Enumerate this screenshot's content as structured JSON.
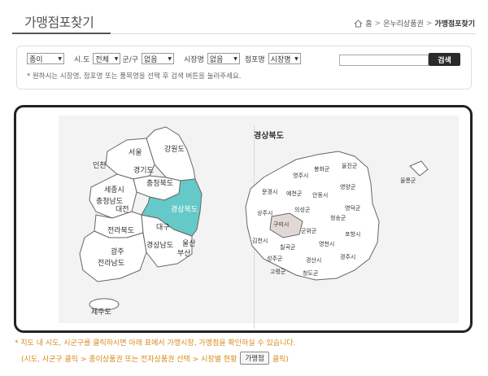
{
  "header": {
    "title": "가맹점포찾기",
    "breadcrumb": [
      "홈",
      "온누리상품권",
      "가맹점포찾기"
    ]
  },
  "search": {
    "type_select": "종이",
    "sido_label": "시.도",
    "sido_select": "전체",
    "gungu_label": "군/구",
    "gungu_select": "없음",
    "market_label": "시장명",
    "market_select": "없음",
    "store_label": "점포명",
    "store_select": "시장명",
    "query_value": "",
    "button_label": "검색",
    "hint": "* 원하시는 시장명, 점포명 또는 품목명을 선택 후 검색 버튼을 눌러주세요."
  },
  "map": {
    "korea_regions": [
      "서울",
      "강원도",
      "인천",
      "경기도",
      "충청북도",
      "세종시",
      "충청남도",
      "대전",
      "경상북도",
      "대구",
      "전라북도",
      "울산",
      "경상남도",
      "광주",
      "부산",
      "전라남도",
      "제주도"
    ],
    "province_title": "경상북도",
    "gb_regions": [
      "울릉군",
      "봉화군",
      "울진군",
      "영주시",
      "문경시",
      "예천군",
      "영양군",
      "안동시",
      "상주시",
      "의성군",
      "영덕군",
      "청송군",
      "구미시",
      "군위군",
      "포항시",
      "김천시",
      "칠곡군",
      "영천시",
      "성주군",
      "경산시",
      "경주시",
      "고령군",
      "청도군"
    ],
    "colors": {
      "highlight": "#66c9c9",
      "selected": "#e2d9d6",
      "frame_dark": "#222222",
      "frame_green": "#7ab62e"
    }
  },
  "notes": {
    "line1": "* 지도 내 시도, 시군구를 클릭하시면 아래 표에서 가맹시장, 가맹점을 확인하실 수 있습니다.",
    "line2_prefix": "(시도, 시군구 클릭 > 종이상품권 또는 전자상품권 선택 > 시장별 현황",
    "line2_button": "가맹점",
    "line2_suffix": "클릭)"
  }
}
